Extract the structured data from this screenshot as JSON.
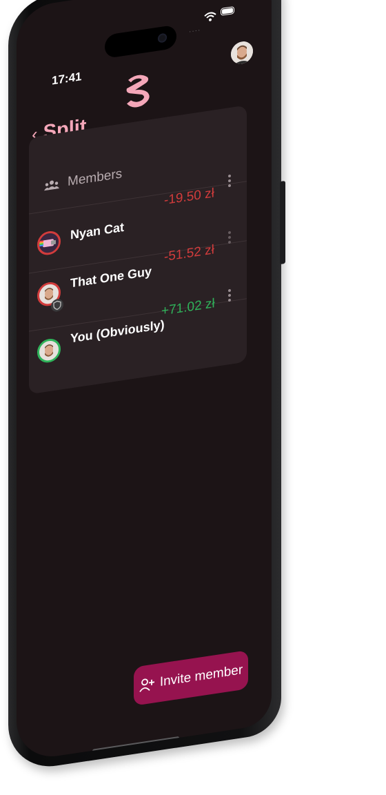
{
  "status": {
    "time": "17:41",
    "signal": "····"
  },
  "header": {
    "back_label": "Split",
    "back_icon": "chevron-left-icon"
  },
  "members": {
    "heading": "Members",
    "items": [
      {
        "name": "Nyan Cat",
        "amount": "-19.50 zł",
        "status": "negative"
      },
      {
        "name": "That One Guy",
        "amount": "-51.52 zł",
        "status": "negative"
      },
      {
        "name": "You (Obviously)",
        "amount": "+71.02 zł",
        "status": "positive"
      }
    ]
  },
  "invite": {
    "label": "Invite member",
    "icon": "person-plus-icon"
  },
  "colors": {
    "accent": "#f4a7b9",
    "button": "#96134f",
    "negative": "#d23c3c",
    "positive": "#2fb35a",
    "background": "#1c1416",
    "card": "#2a2124"
  }
}
